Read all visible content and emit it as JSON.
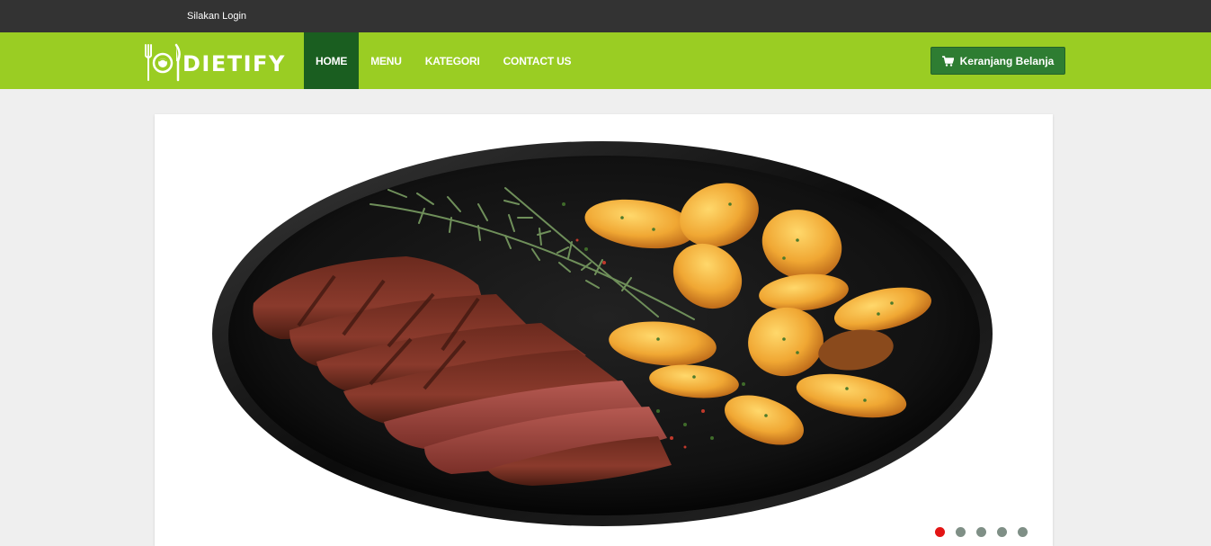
{
  "topbar": {
    "login_text": "Silakan Login"
  },
  "brand": {
    "name": "DIETIFY",
    "logo_icon": "fork-knife-plate-icon"
  },
  "nav": {
    "items": [
      {
        "label": "HOME",
        "active": true
      },
      {
        "label": "MENU",
        "active": false
      },
      {
        "label": "KATEGORI",
        "active": false
      },
      {
        "label": "CONTACT US",
        "active": false
      }
    ]
  },
  "cart": {
    "label": "Keranjang Belanja",
    "icon": "shopping-cart-icon"
  },
  "carousel": {
    "slide_count": 5,
    "active_index": 0,
    "current_image": "steak-with-roasted-potatoes-and-rosemary"
  },
  "colors": {
    "topbar": "#333333",
    "navbar": "#9acd23",
    "nav_active": "#1a5e20",
    "cart_button": "#2e7d32",
    "indicator_active": "#e31414",
    "indicator_inactive": "#7f8f86"
  }
}
